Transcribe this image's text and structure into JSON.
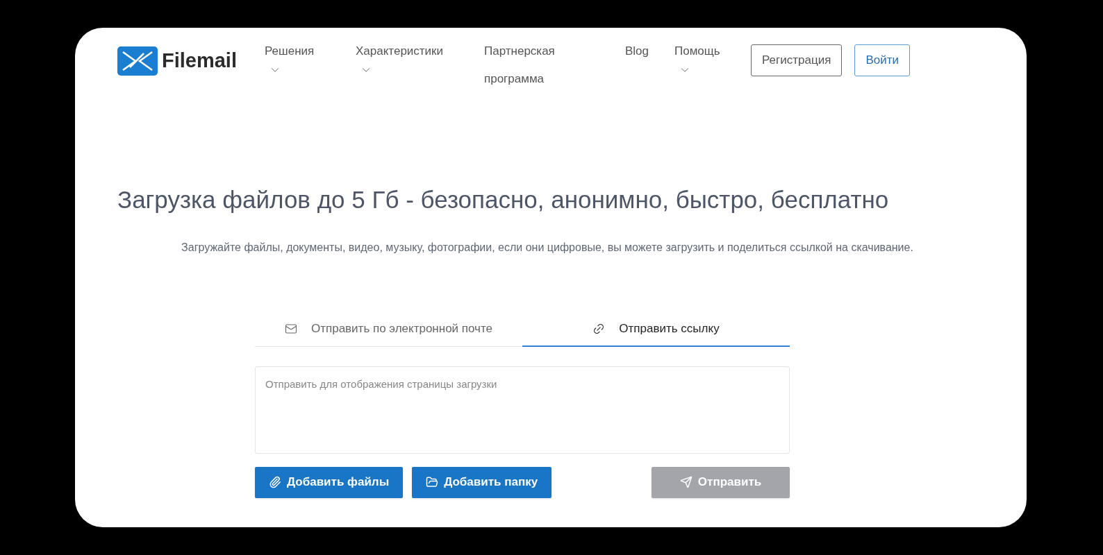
{
  "header": {
    "logo": "Filemail",
    "nav": [
      {
        "label": "Решения",
        "has_menu": true
      },
      {
        "label": "Характеристики",
        "has_menu": true
      },
      {
        "label": "Партнерская программа",
        "has_menu": false
      },
      {
        "label": "Blog",
        "has_menu": false
      },
      {
        "label": "Помощь",
        "has_menu": true
      }
    ],
    "buttons": [
      {
        "label": "Регистрация",
        "kind": "secondary"
      },
      {
        "label": "Войти",
        "kind": "primary"
      }
    ]
  },
  "hero": {
    "title": "Загрузка файлов до 5 Гб - безопасно, анонимно, быстро, бесплатно",
    "subtitle": "Загружайте файлы, документы, видео, музыку, фотографии, если они цифровые, вы можете загрузить и поделиться ссылкой на скачивание."
  },
  "tabs": [
    {
      "label": "Отправить по электронной почте",
      "kind": "email",
      "selected": false
    },
    {
      "label": "Отправить ссылку",
      "kind": "link",
      "selected": true
    }
  ],
  "message": {
    "placeholder": "Отправить для отображения страницы загрузки"
  },
  "actions": [
    {
      "label": "Добавить файлы",
      "kind": "files",
      "disabled": false
    },
    {
      "label": "Добавить папку",
      "kind": "folder",
      "disabled": false
    },
    {
      "label": "Отправить",
      "kind": "send",
      "disabled": true
    }
  ]
}
